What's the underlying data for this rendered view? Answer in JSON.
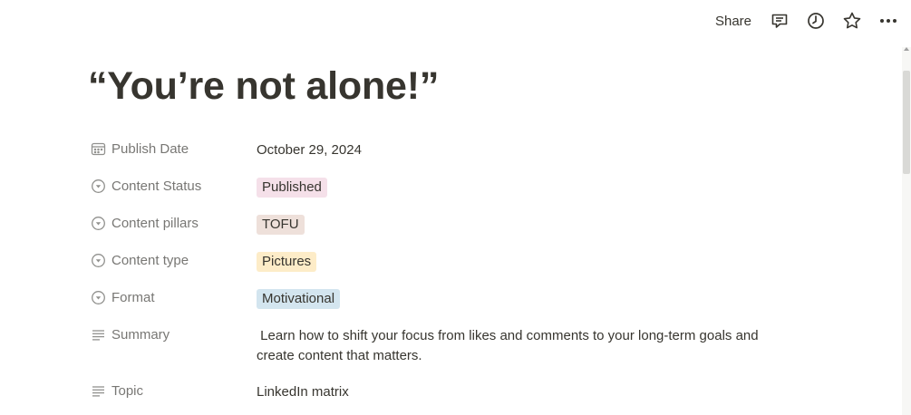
{
  "topbar": {
    "share_label": "Share",
    "icons": [
      "comment-icon",
      "history-icon",
      "star-icon",
      "more-icon"
    ]
  },
  "page": {
    "title": "“You’re not alone!”"
  },
  "properties": {
    "publish_date": {
      "label": "Publish Date",
      "value": "October 29, 2024",
      "icon": "calendar-icon"
    },
    "content_status": {
      "label": "Content Status",
      "value": "Published",
      "icon": "select-icon",
      "color": "#f5e0e9"
    },
    "content_pillars": {
      "label": "Content pillars",
      "value": "TOFU",
      "icon": "select-icon",
      "color": "#eee0da"
    },
    "content_type": {
      "label": "Content type",
      "value": "Pictures",
      "icon": "select-icon",
      "color": "#fdecc8"
    },
    "format": {
      "label": "Format",
      "value": "Motivational",
      "icon": "select-icon",
      "color": "#d3e5ef"
    },
    "summary": {
      "label": "Summary",
      "value": " Learn how to shift your focus from likes and comments to your long-term goals and create content that matters.",
      "icon": "text-icon"
    },
    "topic": {
      "label": "Topic",
      "value": "LinkedIn matrix",
      "icon": "text-icon"
    }
  }
}
